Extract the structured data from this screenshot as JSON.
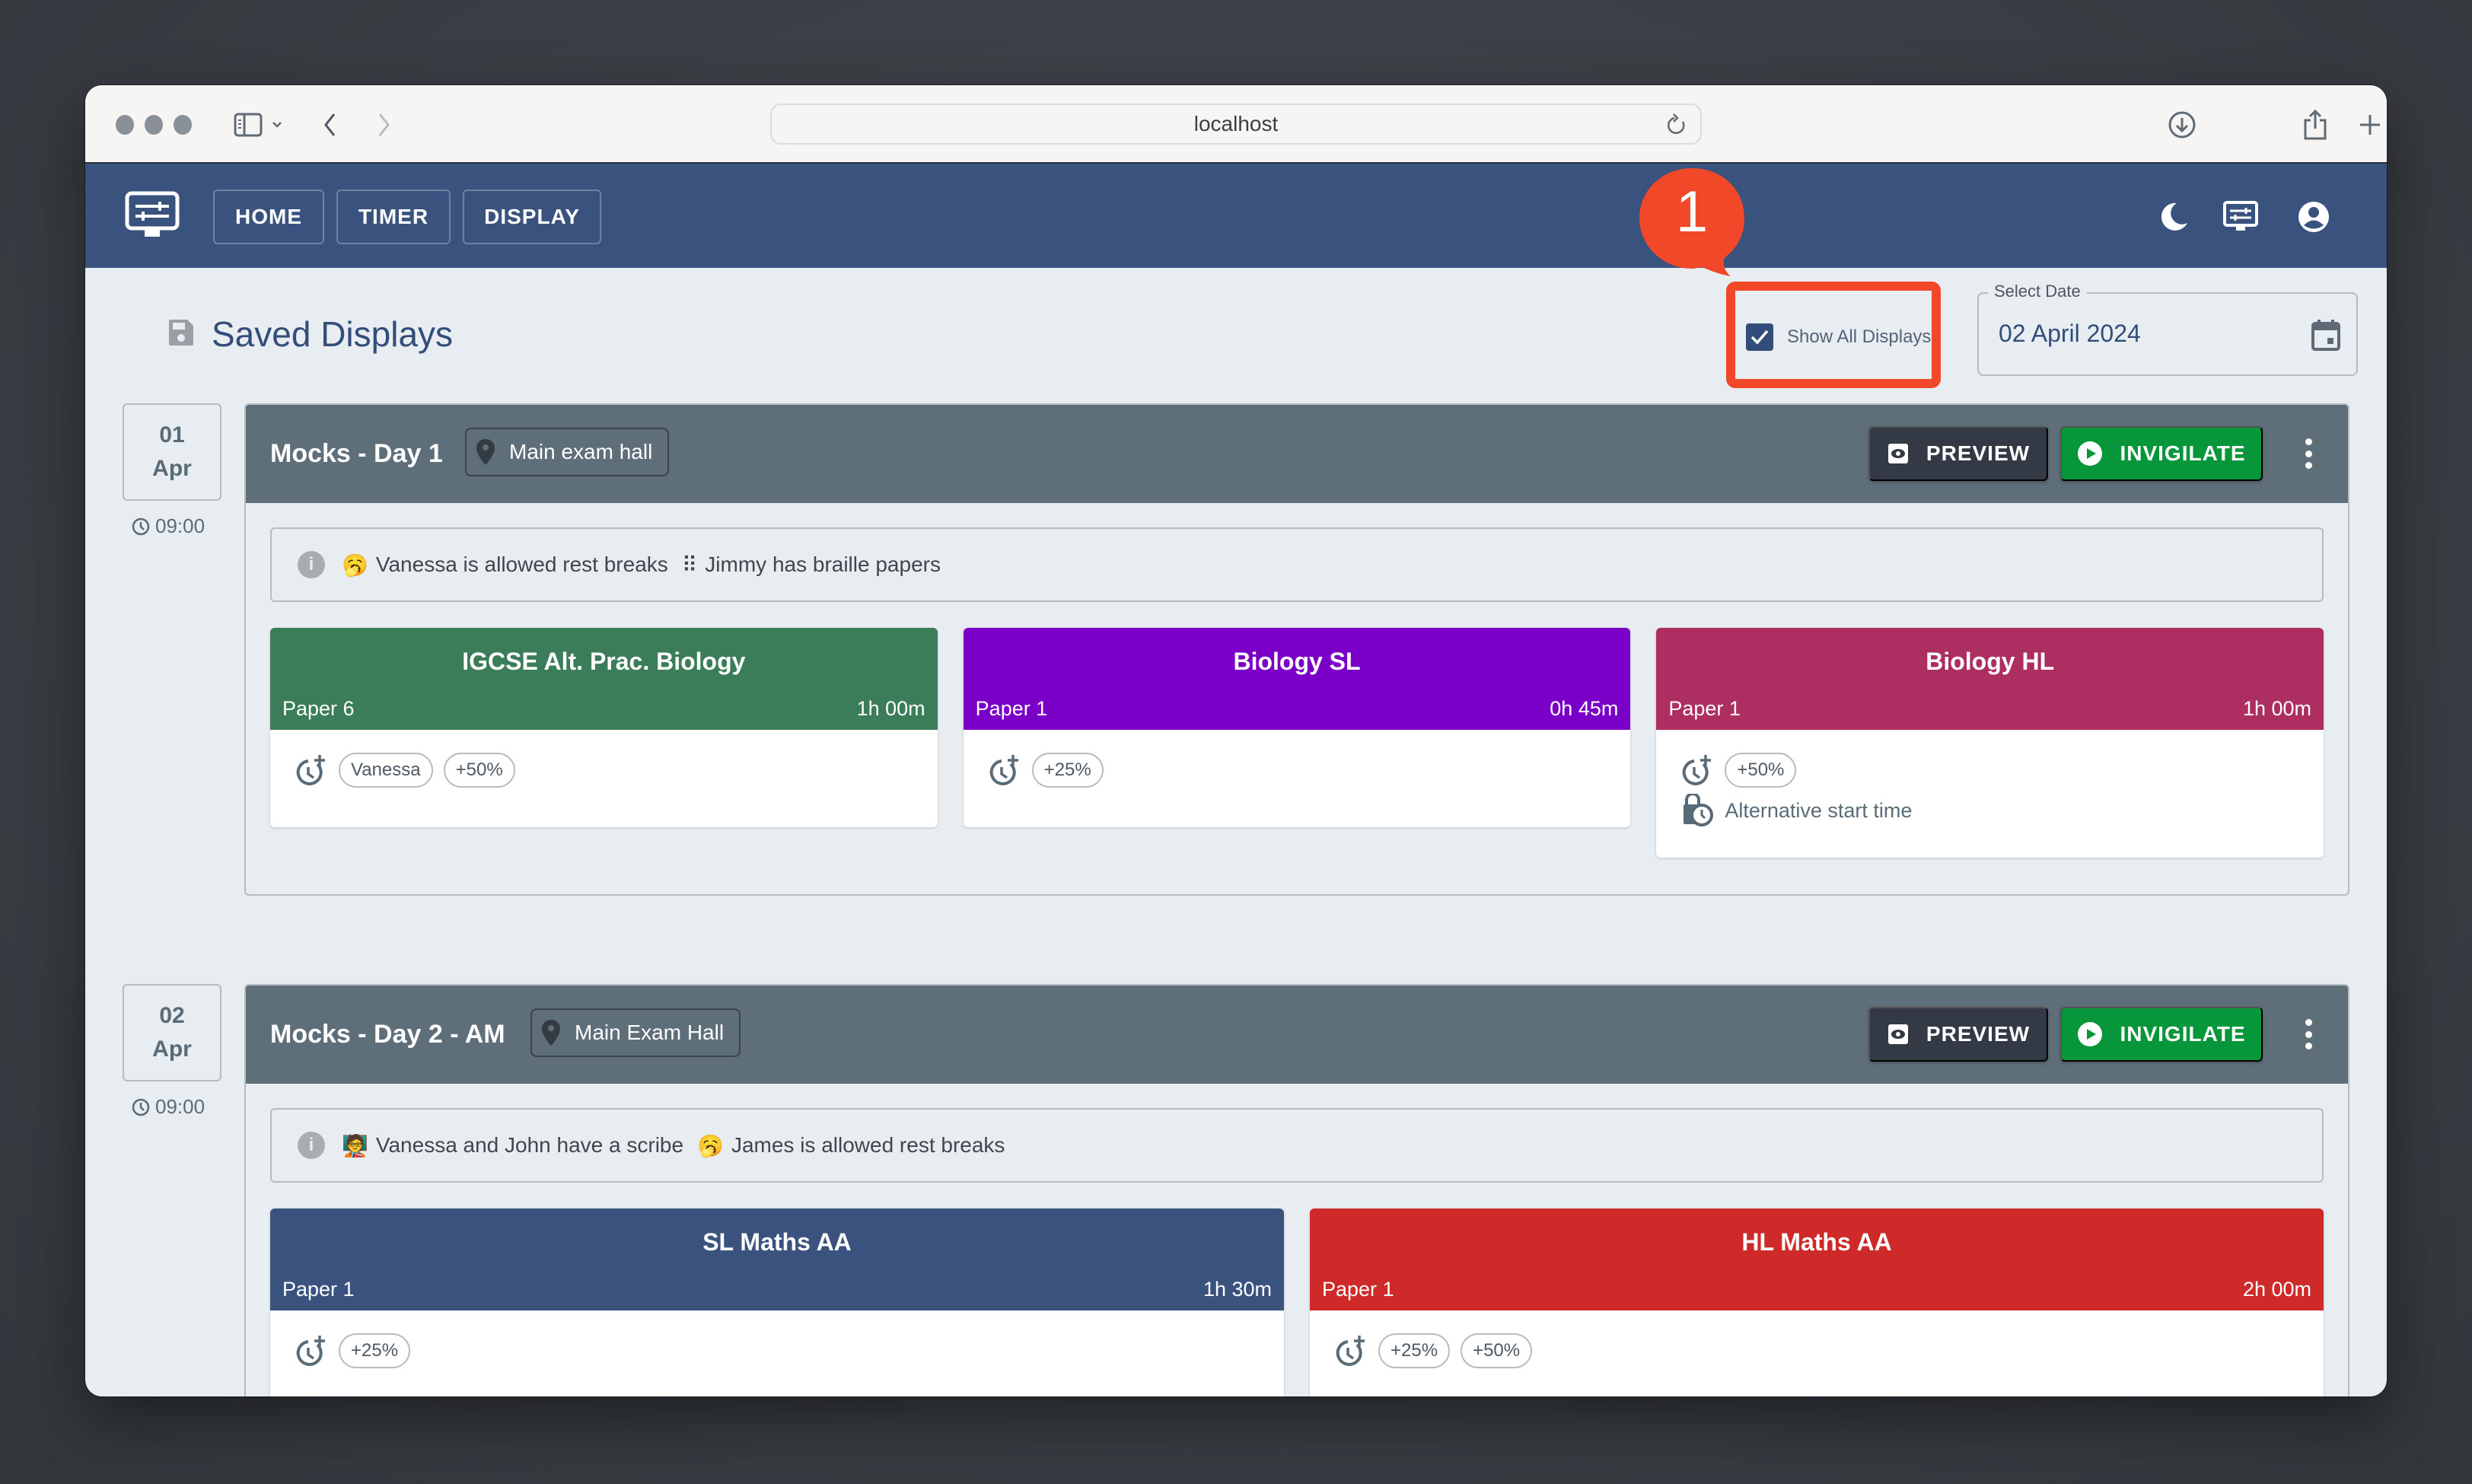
{
  "browser": {
    "url": "localhost"
  },
  "appbar": {
    "nav": [
      {
        "label": "HOME"
      },
      {
        "label": "TIMER"
      },
      {
        "label": "DISPLAY"
      }
    ]
  },
  "page": {
    "title": "Saved Displays",
    "show_all_label": "Show All Displays",
    "show_all_checked": true,
    "date_field_label": "Select Date",
    "date_value": "02 April 2024",
    "annotation_number": "1",
    "annotation_color": "#f1482a"
  },
  "displays": [
    {
      "day": "01",
      "month": "Apr",
      "time": "09:00",
      "title": "Mocks - Day 1",
      "location": "Main exam hall",
      "preview_label": "PREVIEW",
      "invigilate_label": "INVIGILATE",
      "notice": {
        "parts": [
          {
            "emoji": "🥱",
            "text": "Vanessa is allowed rest breaks"
          },
          {
            "emoji": "⠿",
            "text": "Jimmy has braille papers"
          }
        ]
      },
      "exams": [
        {
          "name": "IGCSE Alt. Prac. Biology",
          "paper": "Paper 6",
          "duration": "1h 00m",
          "color": "#3a7d58",
          "extra_time": [
            "Vanessa",
            "+50%"
          ],
          "alt_start": null
        },
        {
          "name": "Biology SL",
          "paper": "Paper 1",
          "duration": "0h 45m",
          "color": "#7a00c8",
          "extra_time": [
            "+25%"
          ],
          "alt_start": null
        },
        {
          "name": "Biology HL",
          "paper": "Paper 1",
          "duration": "1h 00m",
          "color": "#ad2e61",
          "extra_time": [
            "+50%"
          ],
          "alt_start": "Alternative start time"
        }
      ]
    },
    {
      "day": "02",
      "month": "Apr",
      "time": "09:00",
      "title": "Mocks - Day 2 - AM",
      "location": "Main Exam Hall",
      "preview_label": "PREVIEW",
      "invigilate_label": "INVIGILATE",
      "notice": {
        "parts": [
          {
            "emoji": "🧑‍🏫",
            "text": "Vanessa and John have a scribe"
          },
          {
            "emoji": "🥱",
            "text": "James is allowed rest breaks"
          }
        ]
      },
      "exams": [
        {
          "name": "SL Maths AA",
          "paper": "Paper 1",
          "duration": "1h 30m",
          "color": "#39527e",
          "extra_time": [
            "+25%"
          ],
          "alt_start": null
        },
        {
          "name": "HL Maths AA",
          "paper": "Paper 1",
          "duration": "2h 00m",
          "color": "#cf2a2a",
          "extra_time": [
            "+25%",
            "+50%"
          ],
          "alt_start": null
        }
      ]
    }
  ]
}
